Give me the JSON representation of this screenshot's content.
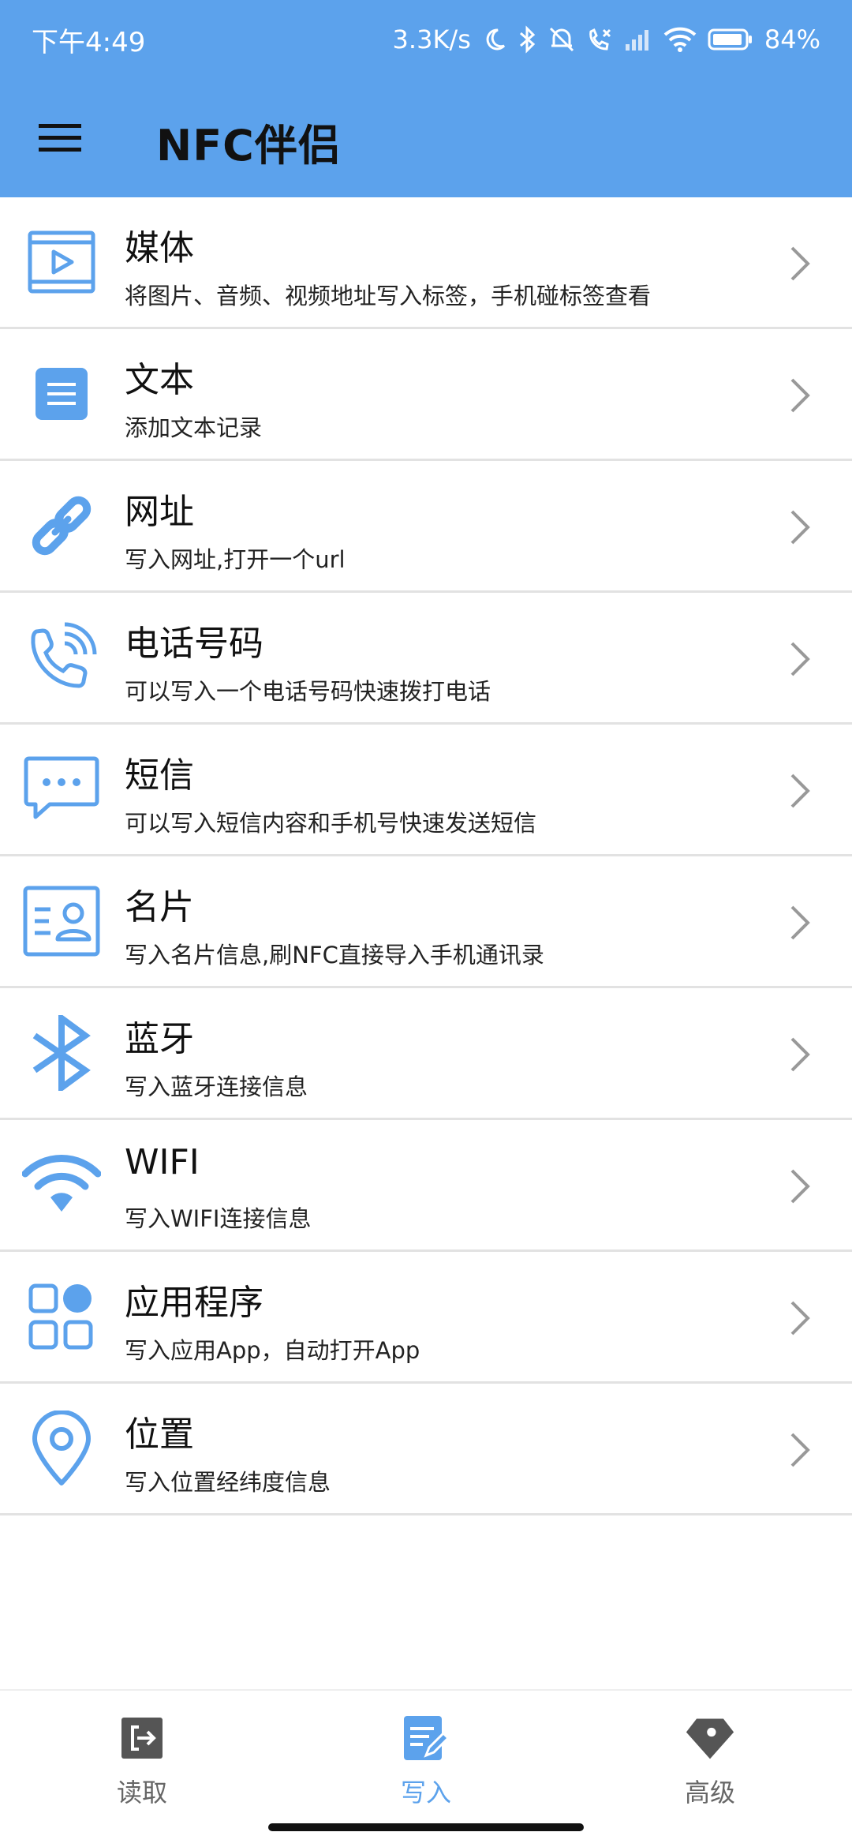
{
  "status": {
    "time": "下午4:49",
    "speed": "3.3K/s",
    "battery": "84%"
  },
  "app": {
    "title": "NFC伴侣"
  },
  "colors": {
    "accent": "#5ca2ec",
    "icon": "#5ca2ec"
  },
  "items": [
    {
      "title": "媒体",
      "subtitle": "将图片、音频、视频地址写入标签，手机碰标签查看",
      "icon": "media-icon"
    },
    {
      "title": "文本",
      "subtitle": "添加文本记录",
      "icon": "text-icon"
    },
    {
      "title": "网址",
      "subtitle": "写入网址,打开一个url",
      "icon": "link-icon"
    },
    {
      "title": "电话号码",
      "subtitle": "可以写入一个电话号码快速拨打电话",
      "icon": "phone-icon"
    },
    {
      "title": "短信",
      "subtitle": "可以写入短信内容和手机号快速发送短信",
      "icon": "sms-icon"
    },
    {
      "title": "名片",
      "subtitle": "写入名片信息,刷NFC直接导入手机通讯录",
      "icon": "contact-card-icon"
    },
    {
      "title": "蓝牙",
      "subtitle": "写入蓝牙连接信息",
      "icon": "bluetooth-icon"
    },
    {
      "title": "WIFI",
      "subtitle": "写入WIFI连接信息",
      "icon": "wifi-icon"
    },
    {
      "title": "应用程序",
      "subtitle": "写入应用App，自动打开App",
      "icon": "apps-icon"
    },
    {
      "title": "位置",
      "subtitle": "写入位置经纬度信息",
      "icon": "location-icon"
    }
  ],
  "nav": {
    "read": "读取",
    "write": "写入",
    "advanced": "高级",
    "active": "write"
  }
}
